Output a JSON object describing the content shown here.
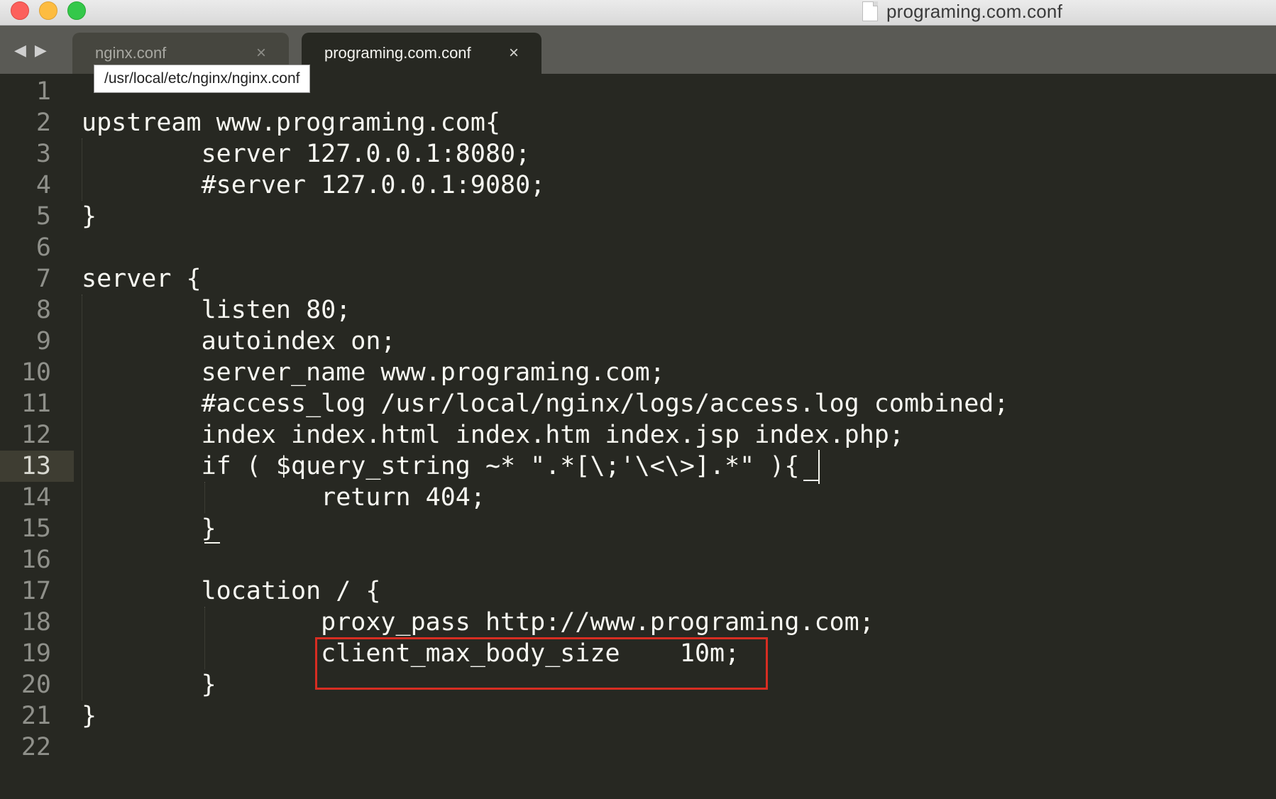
{
  "window": {
    "title": "programing.com.conf"
  },
  "tabs": [
    {
      "label": "nginx.conf",
      "close": "×",
      "active": false
    },
    {
      "label": "programing.com.conf",
      "close": "×",
      "active": true
    }
  ],
  "nav": {
    "back": "◀",
    "forward": "▶"
  },
  "tooltip": {
    "text": "/usr/local/etc/nginx/nginx.conf"
  },
  "editor": {
    "current_line": 13,
    "lines": [
      {
        "num": "1",
        "text": ""
      },
      {
        "num": "2",
        "text": "upstream www.programing.com{"
      },
      {
        "num": "3",
        "text": "        server 127.0.0.1:8080;"
      },
      {
        "num": "4",
        "text": "        #server 127.0.0.1:9080;"
      },
      {
        "num": "5",
        "text": "}"
      },
      {
        "num": "6",
        "text": ""
      },
      {
        "num": "7",
        "text": "server {"
      },
      {
        "num": "8",
        "text": "        listen 80;"
      },
      {
        "num": "9",
        "text": "        autoindex on;"
      },
      {
        "num": "10",
        "text": "        server_name www.programing.com;"
      },
      {
        "num": "11",
        "text": "        #access_log /usr/local/nginx/logs/access.log combined;"
      },
      {
        "num": "12",
        "text": "        index index.html index.htm index.jsp index.php;"
      },
      {
        "num": "13",
        "text": "        if ( $query_string ~* \".*[\\;'\\<\\>].*\" ){"
      },
      {
        "num": "14",
        "text": "                return 404;"
      },
      {
        "num": "15",
        "text": "        }"
      },
      {
        "num": "16",
        "text": ""
      },
      {
        "num": "17",
        "text": "        location / {"
      },
      {
        "num": "18",
        "text": "                proxy_pass http://www.programing.com;"
      },
      {
        "num": "19",
        "text": "                client_max_body_size    10m;"
      },
      {
        "num": "20",
        "text": "        }"
      },
      {
        "num": "21",
        "text": "}"
      },
      {
        "num": "22",
        "text": ""
      }
    ]
  },
  "colors": {
    "background": "#272822",
    "text": "#f8f8f2",
    "gutter_text": "#8f908a",
    "highlight_box": "#d72d22"
  }
}
